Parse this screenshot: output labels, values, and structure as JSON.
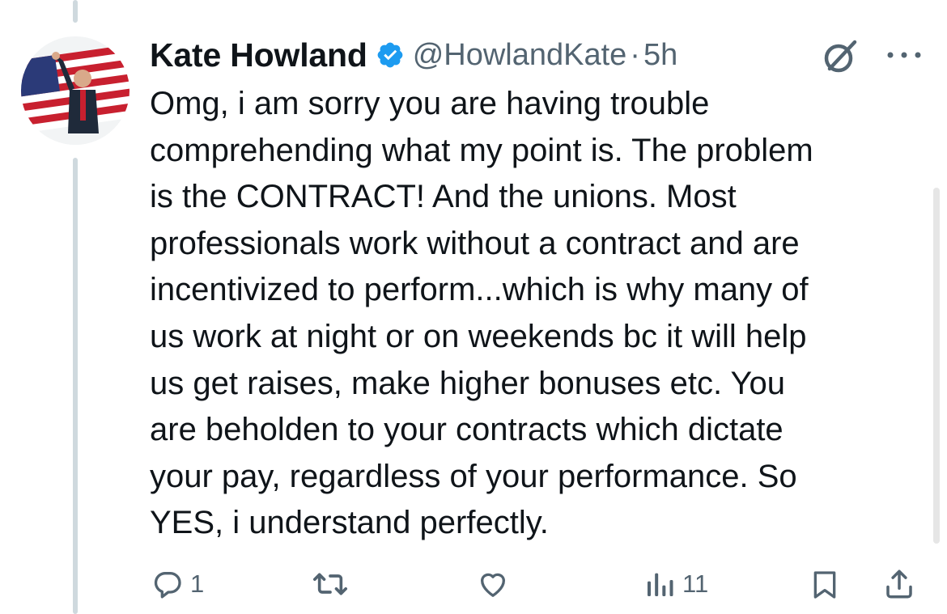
{
  "tweet": {
    "author_name": "Kate Howland",
    "handle": "@HowlandKate",
    "separator": "·",
    "time": "5h",
    "text": "Omg, i am sorry you are having trouble\ncomprehending what my point is. The problem\nis the CONTRACT! And the unions. Most\nprofessionals work without a contract and are\nincentivized to perform...which is why many of\nus work at night or on weekends bc it will help\nus get raises, make higher bonuses etc. You\nare beholden to your contracts which dictate\nyour pay, regardless of your performance. So\nYES, i understand perfectly."
  },
  "actions": {
    "reply_count": "1",
    "retweet_count": "",
    "like_count": "",
    "views_count": "11"
  },
  "colors": {
    "verified": "#1d9bf0",
    "muted": "#536471",
    "thread_line": "#cfd9de"
  },
  "icons": {
    "verified": "verified-badge-icon",
    "grok": "grok-icon",
    "more": "more-icon",
    "reply": "reply-icon",
    "retweet": "retweet-icon",
    "like": "like-icon",
    "views": "views-icon",
    "bookmark": "bookmark-icon",
    "share": "share-icon"
  }
}
